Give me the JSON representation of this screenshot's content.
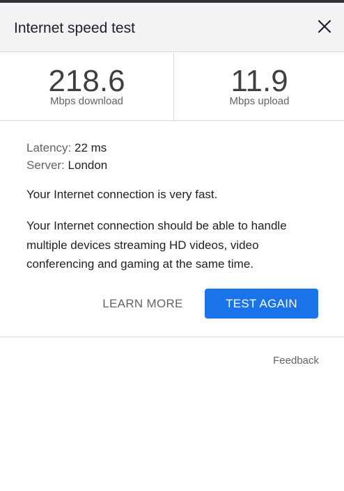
{
  "header": {
    "title": "Internet speed test",
    "close_icon": "close-icon"
  },
  "metrics": {
    "download": {
      "value": "218.6",
      "label": "Mbps download"
    },
    "upload": {
      "value": "11.9",
      "label": "Mbps upload"
    }
  },
  "details": {
    "latency_label": "Latency:",
    "latency_value": "22 ms",
    "server_label": "Server:",
    "server_value": "London"
  },
  "summary": "Your Internet connection is very fast.",
  "description": "Your Internet connection should be able to handle multiple devices streaming HD videos, video conferencing and gaming at the same time.",
  "actions": {
    "learn_more": "LEARN MORE",
    "test_again": "TEST AGAIN"
  },
  "footer": {
    "feedback": "Feedback"
  },
  "colors": {
    "accent": "#1a73e8",
    "header_bg": "#f1f3f4",
    "top_bar": "#303134"
  }
}
